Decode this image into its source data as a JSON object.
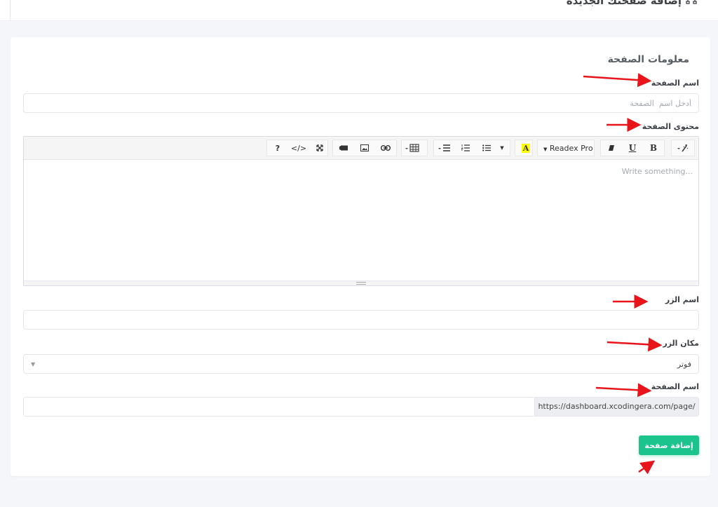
{
  "header": {
    "title": "إضافة صفحتك الجديدة",
    "icon": "sitemap-icon"
  },
  "form": {
    "section_title": "معلومات الصفحة",
    "page_name": {
      "label": "اسم الصفحة",
      "value": "",
      "placeholder": "أدخل اسم  الصفحة"
    },
    "page_content": {
      "label": "محتوى الصفحة",
      "placeholder": "Write something..."
    },
    "editor_toolbar": {
      "font_name": "Readex Pro",
      "bold": "B",
      "underline": "U",
      "help": "?",
      "code": "</>"
    },
    "button_name": {
      "label": "اسم الزر",
      "value": ""
    },
    "button_location": {
      "label": "مكان الزر",
      "selected": "فوتر"
    },
    "page_url": {
      "label": "اسم الصفحة",
      "prefix": "https://dashboard.xcodingera.com/page/",
      "value": ""
    },
    "submit_label": "إضافة صفحة"
  },
  "colors": {
    "accent": "#1bc48c",
    "arrow": "#e8141a",
    "highlight": "#ffff00"
  }
}
